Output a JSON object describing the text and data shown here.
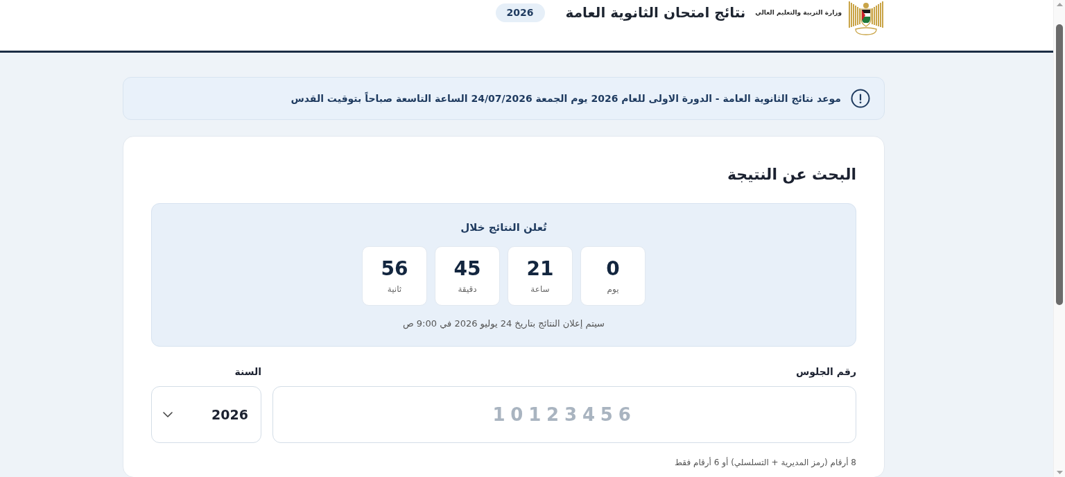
{
  "header": {
    "ministry": "وزارة التربية والتعليم العالي",
    "title": "نتائج امتحان الثانوية العامة",
    "badge": "2026"
  },
  "notice": {
    "text": "موعد نتائج الثانوية العامة - الدورة الاولى للعام 2026 يوم الجمعة 24/07/2026 الساعة التاسعة صباحاً بتوقيت القدس"
  },
  "search_card": {
    "title": "البحث عن النتيجة",
    "countdown": {
      "title": "تُعلن النتائج خلال",
      "units": [
        {
          "value": "0",
          "label": "يوم"
        },
        {
          "value": "21",
          "label": "ساعة"
        },
        {
          "value": "45",
          "label": "دقيقة"
        },
        {
          "value": "56",
          "label": "ثانية"
        }
      ],
      "note": "سيتم إعلان النتائج بتاريخ 24 يوليو 2026 في 9:00 ص"
    },
    "seat_number": {
      "label": "رقم الجلوس",
      "placeholder": "10123456",
      "hint": "8 أرقام (رمز المديرية + التسلسلي) أو 6 أرقام فقط"
    },
    "year": {
      "label": "السنة",
      "value": "2026"
    }
  }
}
